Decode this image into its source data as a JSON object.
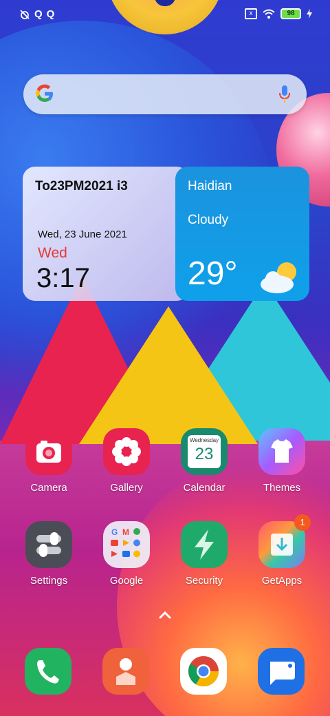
{
  "statusbar": {
    "left_icons": [
      "mute-alarm-icon",
      "q-app-icon",
      "q-app-icon"
    ],
    "sim": "x",
    "battery": "98"
  },
  "search": {
    "logo": "G",
    "mic": "mic-icon"
  },
  "clock_widget": {
    "title": "To23PM2021 i3",
    "date": "Wed, 23 June 2021",
    "day": "Wed",
    "time": "3:17"
  },
  "weather_widget": {
    "city": "Haidian",
    "condition": "Cloudy",
    "temperature": "29°"
  },
  "apps": [
    {
      "label": "Camera"
    },
    {
      "label": "Gallery"
    },
    {
      "label": "Calendar",
      "day_name": "Wednesday",
      "day_number": "23"
    },
    {
      "label": "Themes"
    },
    {
      "label": "Settings"
    },
    {
      "label": "Google"
    },
    {
      "label": "Security"
    },
    {
      "label": "GetApps",
      "badge": "1"
    }
  ],
  "dock": [
    "phone-icon",
    "contacts-icon",
    "chrome-icon",
    "messages-icon"
  ],
  "colors": {
    "red": "#e53935",
    "weather_blue": "#1b93de",
    "badge": "#f45a1f"
  }
}
